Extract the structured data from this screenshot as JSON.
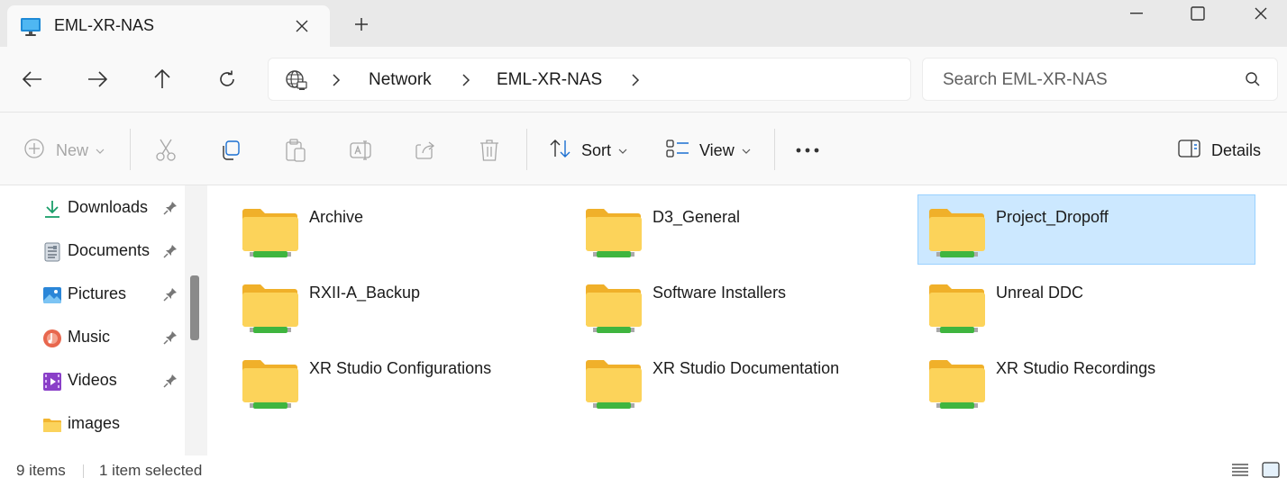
{
  "window": {
    "tab_title": "EML-XR-NAS",
    "tab_icon": "computer-monitor-icon",
    "new_tab_icon": "plus-icon",
    "controls": [
      "minimize-icon",
      "maximize-icon",
      "close-icon"
    ]
  },
  "navigation": {
    "buttons": [
      "back-arrow-icon",
      "forward-arrow-icon",
      "up-arrow-icon",
      "refresh-icon"
    ],
    "breadcrumb": [
      "Network",
      "EML-XR-NAS"
    ],
    "search_placeholder": "Search EML-XR-NAS"
  },
  "toolbar": {
    "new_label": "New",
    "sort_label": "Sort",
    "view_label": "View",
    "details_label": "Details",
    "icons": [
      "cut-icon",
      "copy-icon",
      "paste-icon",
      "rename-icon",
      "share-icon",
      "delete-icon",
      "more-icon"
    ]
  },
  "sidebar": {
    "items": [
      {
        "label": "Downloads",
        "icon": "download-icon",
        "pinned": true
      },
      {
        "label": "Documents",
        "icon": "documents-icon",
        "pinned": true
      },
      {
        "label": "Pictures",
        "icon": "pictures-icon",
        "pinned": true
      },
      {
        "label": "Music",
        "icon": "music-icon",
        "pinned": true
      },
      {
        "label": "Videos",
        "icon": "videos-icon",
        "pinned": true
      },
      {
        "label": "images",
        "icon": "folder-icon",
        "pinned": false
      }
    ]
  },
  "content": {
    "folders": [
      {
        "name": "Archive",
        "selected": false
      },
      {
        "name": "D3_General",
        "selected": false
      },
      {
        "name": "Project_Dropoff",
        "selected": true
      },
      {
        "name": "RXII-A_Backup",
        "selected": false
      },
      {
        "name": "Software Installers",
        "selected": false
      },
      {
        "name": "Unreal DDC",
        "selected": false
      },
      {
        "name": "XR Studio Configurations",
        "selected": false
      },
      {
        "name": "XR Studio Documentation",
        "selected": false
      },
      {
        "name": "XR Studio Recordings",
        "selected": false
      }
    ]
  },
  "status": {
    "item_count": "9 items",
    "selection": "1 item selected"
  },
  "colors": {
    "selection_bg": "#cce8ff",
    "selection_border": "#99d1ff",
    "folder_yellow": "#f8c944",
    "share_green": "#3fb53f"
  }
}
